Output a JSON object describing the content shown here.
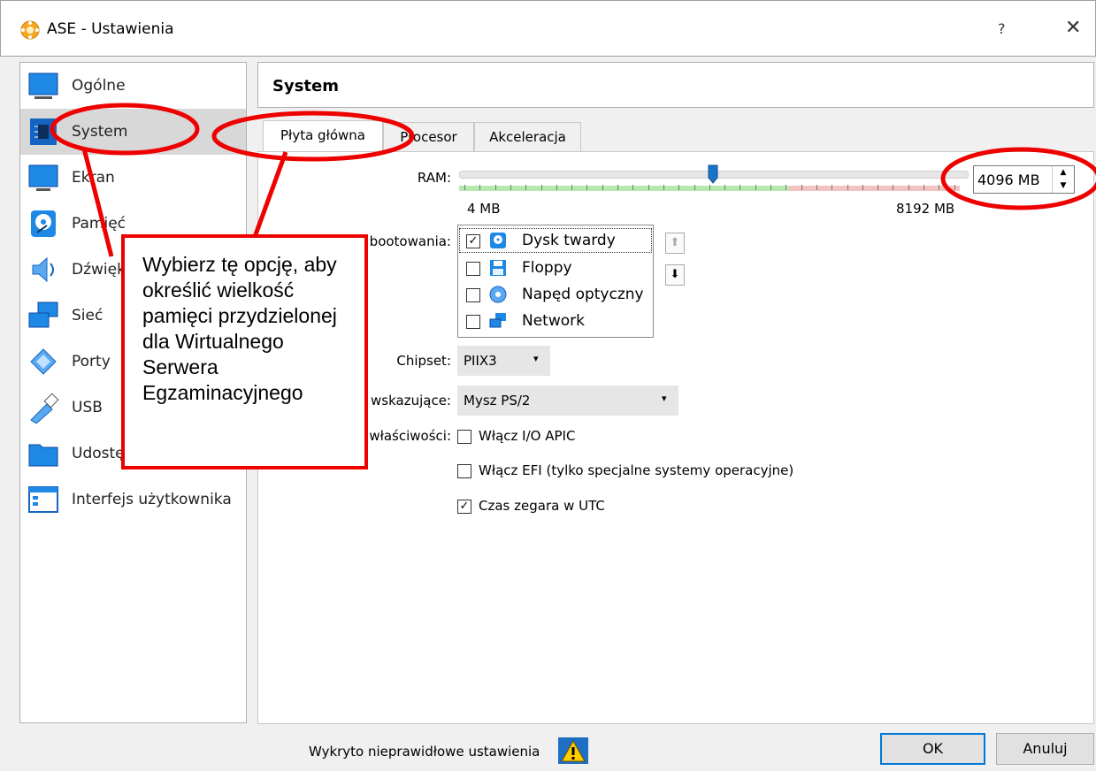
{
  "window": {
    "title": "ASE - Ustawienia",
    "help": "?",
    "close": "✕",
    "app_icon": "virtualbox-icon"
  },
  "sidebar": {
    "selected": "System",
    "items": [
      {
        "label": "Ogólne",
        "icon": "general-icon"
      },
      {
        "label": "System",
        "icon": "system-chip-icon"
      },
      {
        "label": "Ekran",
        "icon": "display-icon"
      },
      {
        "label": "Pamięć",
        "icon": "storage-icon"
      },
      {
        "label": "Dźwięk",
        "icon": "audio-icon"
      },
      {
        "label": "Sieć",
        "icon": "network-icon"
      },
      {
        "label": "Porty",
        "icon": "ports-icon"
      },
      {
        "label": "USB",
        "icon": "usb-icon"
      },
      {
        "label": "Udostępnione foldery",
        "icon": "folder-icon"
      },
      {
        "label": "Interfejs użytkownika",
        "icon": "ui-icon"
      }
    ]
  },
  "header": {
    "title": "System"
  },
  "tabs": [
    {
      "label": "Płyta główna",
      "active": true
    },
    {
      "label": "Procesor",
      "active": false
    },
    {
      "label": "Akceleracja",
      "active": false
    }
  ],
  "motherboard": {
    "ram_label": "RAM:",
    "ram_min_label": "4 MB",
    "ram_max_label": "8192 MB",
    "ram_value": "4096 MB",
    "ram_fraction": 0.5,
    "ram_safe_fraction": 0.65,
    "boot_label": "Kolejność bootowania:",
    "boot_order": [
      {
        "label": "Dysk twardy",
        "checked": true,
        "icon": "hard-disk-icon"
      },
      {
        "label": "Floppy",
        "checked": false,
        "icon": "floppy-icon"
      },
      {
        "label": "Napęd optyczny",
        "checked": false,
        "icon": "optical-drive-icon"
      },
      {
        "label": "Network",
        "checked": false,
        "icon": "network-boot-icon"
      }
    ],
    "chipset_label": "Chipset:",
    "chipset_value": "PIIX3",
    "pointing_label": "Urządzenie wskazujące:",
    "pointing_value": "Mysz PS/2",
    "features_label": "Rozszerzone właściwości:",
    "features": [
      {
        "label": "Włącz I/O APIC",
        "checked": false
      },
      {
        "label": "Włącz EFI (tylko specjalne systemy operacyjne)",
        "checked": false
      },
      {
        "label": "Czas zegara w UTC",
        "checked": true
      }
    ]
  },
  "footer": {
    "status": "Wykryto nieprawidłowe ustawienia",
    "status_icon": "warning-icon",
    "ok": "OK",
    "cancel": "Anuluj"
  },
  "annotation": {
    "text": "Wybierz tę opcję, aby określić wielkość pamięci przydzielonej dla Wirtualnego Serwera Egzaminacyjnego",
    "color": "#e00000"
  },
  "colors": {
    "accent": "#0078d7",
    "selected_bg": "#d8d8d8"
  }
}
